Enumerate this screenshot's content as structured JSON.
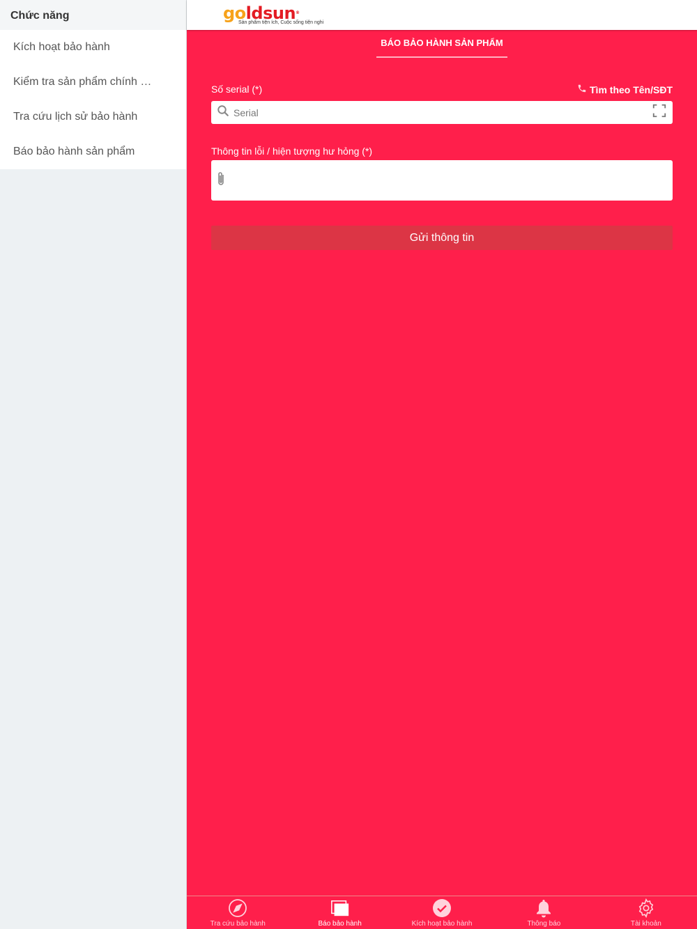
{
  "sidebar": {
    "header": "Chức năng",
    "items": [
      {
        "label": "Kích hoạt bảo hành"
      },
      {
        "label": "Kiểm tra sản phẩm chính hãng"
      },
      {
        "label": "Tra cứu lịch sử bảo hành"
      },
      {
        "label": "Báo bảo hành sản phẩm"
      }
    ]
  },
  "brand": {
    "name_part1": "go",
    "name_part2": "ldsun",
    "reg": "®",
    "tagline": "Sản phẩm tiện ích, Cuộc sống tiện nghi"
  },
  "page": {
    "tab_title": "BÁO BẢO HÀNH SẢN PHẨM"
  },
  "form": {
    "serial_label": "Số serial (*)",
    "search_by_name_link": "Tìm theo Tên/SĐT",
    "serial_placeholder": "Serial",
    "serial_value": "",
    "description_label": "Thông tin lỗi / hiện tượng hư hỏng (*)",
    "description_value": "",
    "submit_label": "Gửi thông tin"
  },
  "bottom_nav": [
    {
      "label": "Tra cứu bảo hành",
      "icon": "compass-icon",
      "active": false
    },
    {
      "label": "Báo bảo hành",
      "icon": "cards-icon",
      "active": true
    },
    {
      "label": "Kích hoạt bảo hành",
      "icon": "check-circle-icon",
      "active": false
    },
    {
      "label": "Thông báo",
      "icon": "bell-icon",
      "active": false
    },
    {
      "label": "Tài khoản",
      "icon": "gear-icon",
      "active": false
    }
  ],
  "colors": {
    "primary": "#ff1f4b",
    "submit_button": "#dc3545"
  }
}
